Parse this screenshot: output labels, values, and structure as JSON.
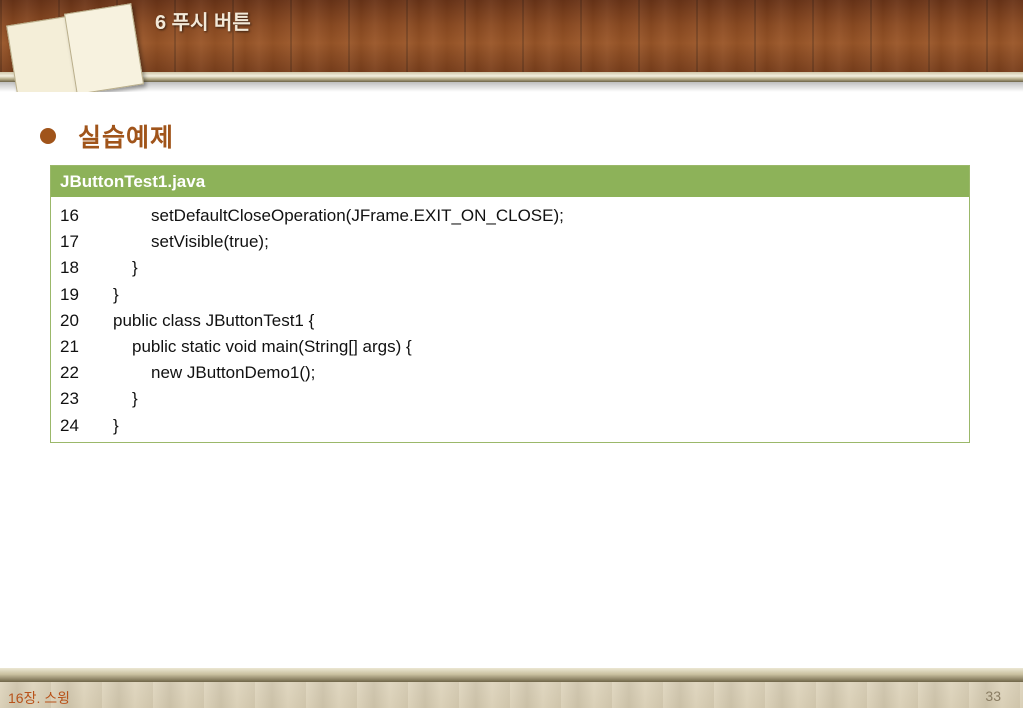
{
  "header": {
    "title": "6 푸시 버튼"
  },
  "section": {
    "title": "실습예제"
  },
  "code_panel": {
    "filename": "JButtonTest1.java",
    "lines": [
      {
        "num": "16",
        "indent": 2,
        "text": "setDefaultCloseOperation(JFrame.EXIT_ON_CLOSE);"
      },
      {
        "num": "17",
        "indent": 2,
        "text": "setVisible(true);"
      },
      {
        "num": "18",
        "indent": 1,
        "text": "}"
      },
      {
        "num": "19",
        "indent": 0,
        "text": "}"
      },
      {
        "num": "20",
        "indent": 0,
        "text": "public class JButtonTest1 {"
      },
      {
        "num": "21",
        "indent": 1,
        "text": "public static void main(String[] args) {"
      },
      {
        "num": "22",
        "indent": 2,
        "text": "new JButtonDemo1();"
      },
      {
        "num": "23",
        "indent": 1,
        "text": "}"
      },
      {
        "num": "24",
        "indent": 0,
        "text": "}"
      }
    ]
  },
  "footer": {
    "chapter": "16장. 스윙",
    "page": "33"
  },
  "colors": {
    "accent": "#a0541a",
    "code_header": "#8db259",
    "code_border": "#9bb86a"
  }
}
